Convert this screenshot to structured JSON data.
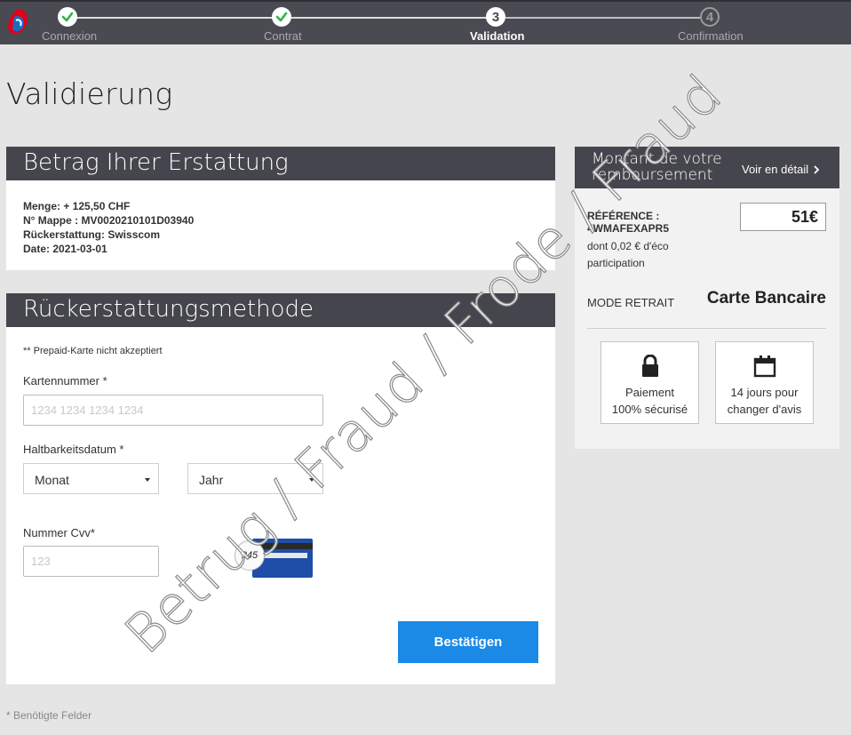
{
  "stepper": {
    "steps": [
      {
        "label": "Connexion",
        "state": "done"
      },
      {
        "label": "Contrat",
        "state": "done"
      },
      {
        "label": "Validation",
        "state": "active",
        "number": "3"
      },
      {
        "label": "Confirmation",
        "state": "future",
        "number": "4"
      }
    ]
  },
  "page": {
    "title": "Validierung"
  },
  "refund": {
    "title": "Betrag Ihrer Erstattung",
    "lines": [
      "Menge: + 125,50 CHF",
      "N° Mappe : MV0020210101D03940",
      "Rückerstattung: Swisscom",
      "Date: 2021-03-01"
    ]
  },
  "method": {
    "title": "Rückerstattungsmethode",
    "note": "** Prepaid-Karte nicht akzeptiert",
    "card_label": "Kartennummer *",
    "card_placeholder": "1234 1234 1234 1234",
    "expiry_label": "Haltbarkeitsdatum *",
    "month_value": "Monat",
    "year_value": "Jahr",
    "cvv_label": "Nummer Cvv*",
    "cvv_placeholder": "123",
    "cvv_sample": "245",
    "confirm_label": "Bestätigen"
  },
  "footnote": "* Benötigte Felder",
  "summary": {
    "title": "Montant de votre remboursement",
    "detail_link": "Voir en détail",
    "reference_label": "RÉFÉRENCE :",
    "reference_value": "4WMAFEXAPR5",
    "eco_line1": "dont 0,02 € d'éco",
    "eco_line2": "participation",
    "amount": "51€",
    "mode_label": "MODE RETRAIT",
    "mode_value": "Carte Bancaire",
    "features": [
      {
        "icon": "lock-icon",
        "line1": "Paiement",
        "line2": "100% sécurisé"
      },
      {
        "icon": "calendar-icon",
        "line1": "14 jours pour",
        "line2": "changer d'avis"
      }
    ]
  },
  "watermark": "Betrug / Fraud / Frode / Fraud",
  "colors": {
    "header": "#45454d",
    "accent": "#1a8ae6",
    "success": "#2fb34a"
  }
}
